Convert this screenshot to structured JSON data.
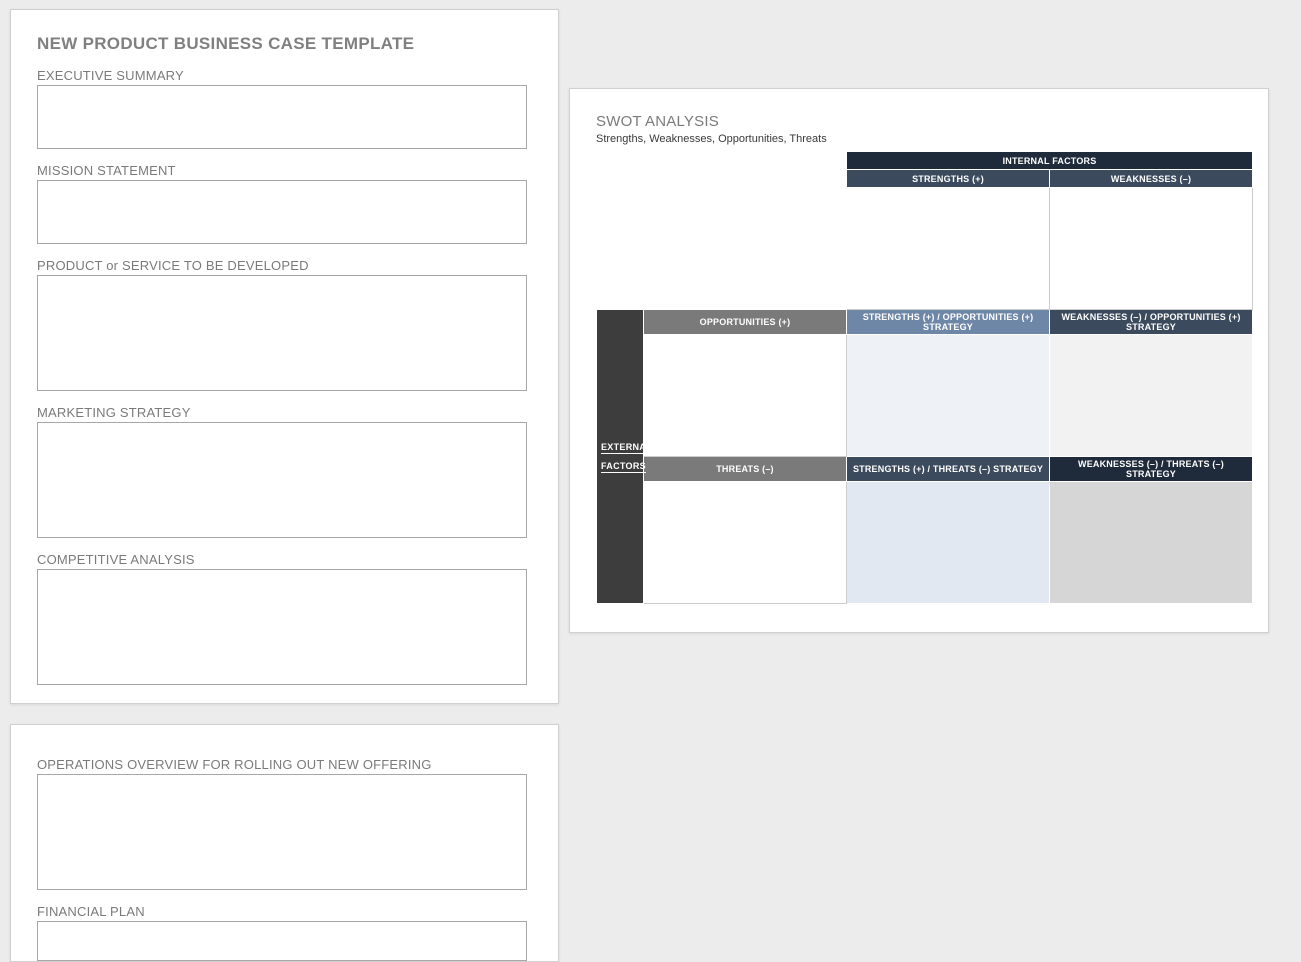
{
  "doc": {
    "title": "NEW PRODUCT BUSINESS CASE TEMPLATE",
    "sections": {
      "exec": "EXECUTIVE SUMMARY",
      "mission": "MISSION STATEMENT",
      "product": "PRODUCT or SERVICE TO BE DEVELOPED",
      "marketing": "MARKETING STRATEGY",
      "competitive": "COMPETITIVE ANALYSIS",
      "operations": "OPERATIONS OVERVIEW FOR ROLLING OUT NEW OFFERING",
      "financial": "FINANCIAL PLAN"
    }
  },
  "swot": {
    "title": "SWOT ANALYSIS",
    "subtitle": "Strengths, Weaknesses, Opportunities, Threats",
    "internal_label": "INTERNAL   FACTORS",
    "external_label_1": "EXTERNAL",
    "external_label_2": "FACTORS",
    "strengths": "STRENGTHS (+)",
    "weaknesses": "WEAKNESSES (–)",
    "opportunities": "OPPORTUNITIES (+)",
    "threats": "THREATS (–)",
    "so": "STRENGTHS (+) / OPPORTUNITIES (+) STRATEGY",
    "wo": "WEAKNESSES (–) / OPPORTUNITIES (+) STRATEGY",
    "st": "STRENGTHS (+) / THREATS (–) STRATEGY",
    "wt": "WEAKNESSES (–) / THREATS (–) STRATEGY"
  }
}
